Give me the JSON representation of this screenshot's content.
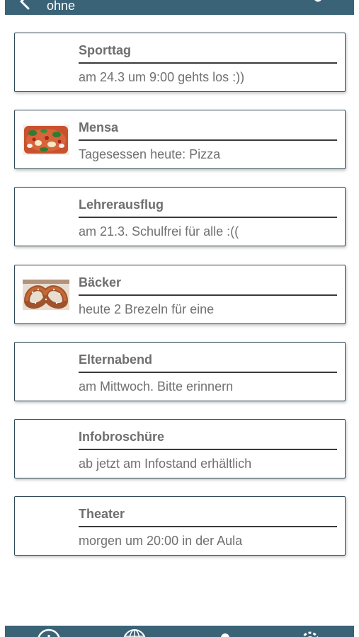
{
  "header": {
    "title": "ohne",
    "back_icon": "chevron-left-icon",
    "right_icon": "action-icon"
  },
  "news": [
    {
      "title": "Sporttag",
      "subtitle": "am 24.3 um 9:00 gehts los :))",
      "image": ""
    },
    {
      "title": "Mensa",
      "subtitle": "Tagesessen heute: Pizza",
      "image": "pizza-thumbnail"
    },
    {
      "title": "Lehrerausflug",
      "subtitle": "am 21.3. Schulfrei für alle :((",
      "image": ""
    },
    {
      "title": "Bäcker",
      "subtitle": "heute 2 Brezeln für eine",
      "image": "pretzel-thumbnail"
    },
    {
      "title": "Elternabend",
      "subtitle": "am Mittwoch. Bitte erinnern",
      "image": ""
    },
    {
      "title": "Infobroschüre",
      "subtitle": "ab jetzt am Infostand erhältlich",
      "image": ""
    },
    {
      "title": "Theater",
      "subtitle": "morgen um 20:00 in der Aula",
      "image": ""
    }
  ],
  "tabbar": {
    "icons": [
      "info-icon",
      "globe-icon",
      "profile-icon",
      "gear-icon"
    ]
  },
  "colors": {
    "bar": "#3a6377",
    "card_border": "#2f4a57",
    "text": "#707070"
  }
}
